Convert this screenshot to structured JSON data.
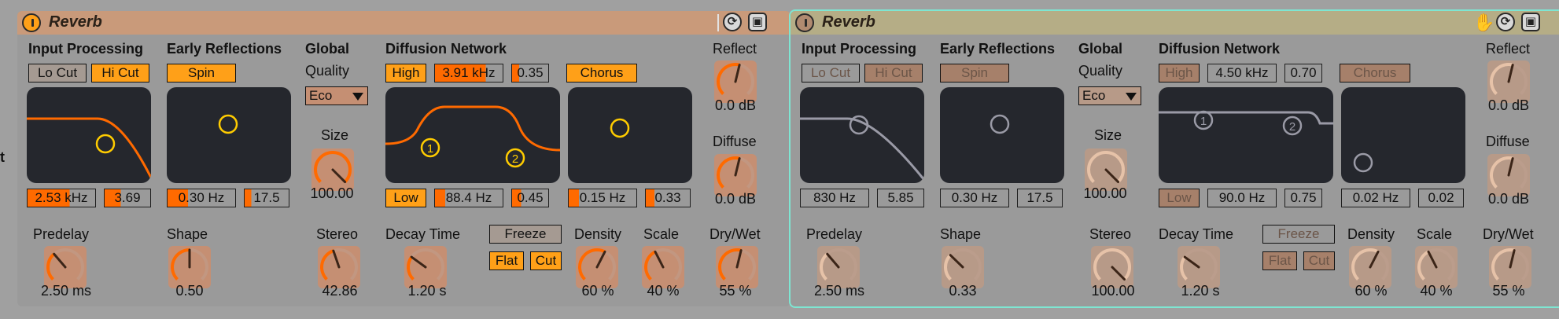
{
  "devices": [
    {
      "title": "Reverb",
      "labels": {
        "input_processing": "Input Processing",
        "early_reflections": "Early Reflections",
        "global": "Global",
        "quality": "Quality",
        "diffusion_network": "Diffusion Network",
        "reflect": "Reflect",
        "diffuse": "Diffuse",
        "size": "Size",
        "predelay": "Predelay",
        "shape": "Shape",
        "stereo": "Stereo",
        "decay_time": "Decay Time",
        "density": "Density",
        "scale": "Scale",
        "dry_wet": "Dry/Wet"
      },
      "buttons": {
        "lo_cut": "Lo Cut",
        "hi_cut": "Hi Cut",
        "spin": "Spin",
        "high": "High",
        "chorus": "Chorus",
        "low": "Low",
        "freeze": "Freeze",
        "flat": "Flat",
        "cut": "Cut"
      },
      "quality_value": "Eco",
      "values": {
        "input_freq": "2.53 kHz",
        "input_width": "3.69",
        "spin_rate": "0.30 Hz",
        "spin_amount": "17.5",
        "high_freq": "3.91 kHz",
        "high_q": "0.35",
        "low_freq": "88.4 Hz",
        "low_q": "0.45",
        "chorus_rate": "0.15 Hz",
        "chorus_amount": "0.33",
        "reflect": "0.0 dB",
        "diffuse": "0.0 dB",
        "size": "100.00",
        "predelay": "2.50 ms",
        "shape": "0.50",
        "stereo": "42.86",
        "decay_time": "1.20 s",
        "density": "60 %",
        "scale": "40 %",
        "dry_wet": "55 %"
      },
      "markers": {
        "one": "1",
        "two": "2"
      },
      "colors": {
        "title": "#c99a7a",
        "active": "#ffa018",
        "accent": "#ff6a00",
        "knob_arc": "#ff6a00"
      }
    },
    {
      "title": "Reverb",
      "labels": {
        "input_processing": "Input Processing",
        "early_reflections": "Early Reflections",
        "global": "Global",
        "quality": "Quality",
        "diffusion_network": "Diffusion Network",
        "reflect": "Reflect",
        "diffuse": "Diffuse",
        "size": "Size",
        "predelay": "Predelay",
        "shape": "Shape",
        "stereo": "Stereo",
        "decay_time": "Decay Time",
        "density": "Density",
        "scale": "Scale",
        "dry_wet": "Dry/Wet"
      },
      "buttons": {
        "lo_cut": "Lo Cut",
        "hi_cut": "Hi Cut",
        "spin": "Spin",
        "high": "High",
        "chorus": "Chorus",
        "low": "Low",
        "freeze": "Freeze",
        "flat": "Flat",
        "cut": "Cut"
      },
      "quality_value": "Eco",
      "values": {
        "input_freq": "830 Hz",
        "input_width": "5.85",
        "spin_rate": "0.30 Hz",
        "spin_amount": "17.5",
        "high_freq": "4.50 kHz",
        "high_q": "0.70",
        "low_freq": "90.0 Hz",
        "low_q": "0.75",
        "chorus_rate": "0.02 Hz",
        "chorus_amount": "0.02",
        "reflect": "0.0 dB",
        "diffuse": "0.0 dB",
        "size": "100.00",
        "predelay": "2.50 ms",
        "shape": "0.33",
        "stereo": "100.00",
        "decay_time": "1.20 s",
        "density": "60 %",
        "scale": "40 %",
        "dry_wet": "55 %"
      },
      "markers": {
        "one": "1",
        "two": "2"
      },
      "colors": {
        "title": "#b5ad86",
        "active": "#a6806a",
        "accent": "#c0a090",
        "knob_arc": "#e6c2a8"
      }
    }
  ]
}
